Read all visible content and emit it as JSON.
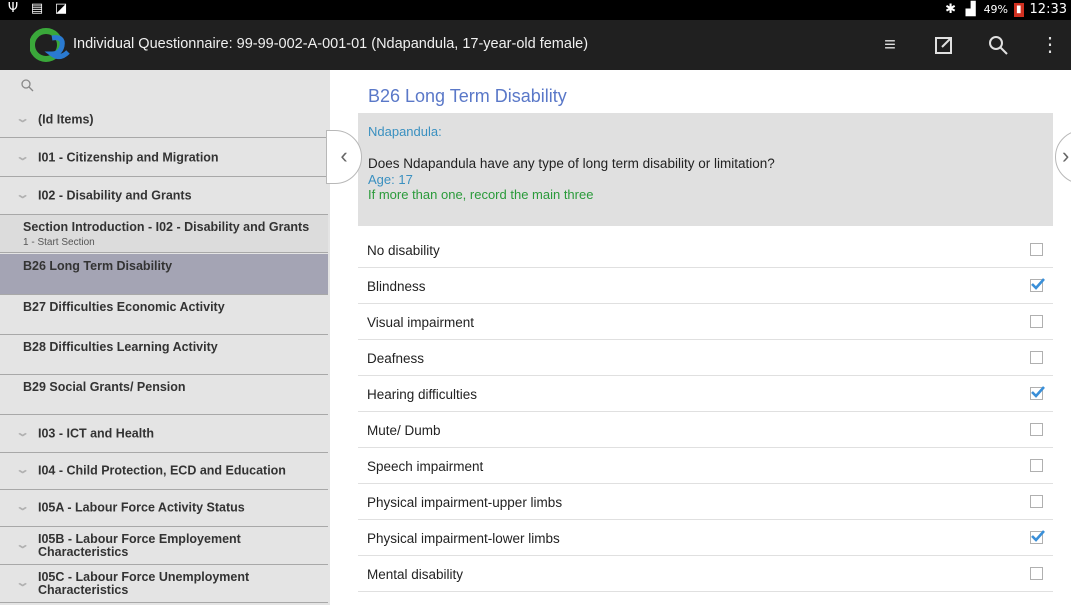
{
  "status_bar": {
    "battery": "49%",
    "time": "12:33"
  },
  "app": {
    "title": "Individual Questionnaire: 99-99-002-A-001-01 (Ndapandula, 17-year-old female)"
  },
  "sidebar": {
    "items": [
      {
        "label": "(Id Items)"
      },
      {
        "label": "I01 - Citizenship and Migration"
      },
      {
        "label": "I02 - Disability and Grants"
      },
      {
        "label": "Section Introduction - I02 - Disability and Grants",
        "sub": "1 - Start Section"
      },
      {
        "label": "B26 Long Term Disability"
      },
      {
        "label": "B27 Difficulties Economic Activity"
      },
      {
        "label": "B28 Difficulties Learning Activity"
      },
      {
        "label": "B29 Social Grants/ Pension"
      },
      {
        "label": "I03 - ICT and Health"
      },
      {
        "label": "I04 - Child Protection, ECD and Education"
      },
      {
        "label": "I05A - Labour Force Activity Status"
      },
      {
        "label": "I05B - Labour Force Employement Characteristics"
      },
      {
        "label": "I05C - Labour Force Unemployment Characteristics"
      }
    ]
  },
  "question": {
    "title": "B26 Long Term Disability",
    "respondent": "Ndapandula:",
    "text": "Does Ndapandula have any type of long term disability or limitation?",
    "age": "Age: 17",
    "note": "If more than one, record the main three"
  },
  "options": [
    {
      "label": "No disability",
      "checked": false
    },
    {
      "label": "Blindness",
      "checked": true
    },
    {
      "label": "Visual impairment",
      "checked": false
    },
    {
      "label": "Deafness",
      "checked": false
    },
    {
      "label": "Hearing difficulties",
      "checked": true
    },
    {
      "label": "Mute/ Dumb",
      "checked": false
    },
    {
      "label": "Speech impairment",
      "checked": false
    },
    {
      "label": "Physical impairment-upper limbs",
      "checked": false
    },
    {
      "label": "Physical impairment-lower limbs",
      "checked": true
    },
    {
      "label": "Mental disability",
      "checked": false
    }
  ],
  "colors": {
    "accent": "#5a78c8",
    "checkmark": "#3a8fd8",
    "note": "#2a9a3a",
    "active_nav": "#a4a4b4"
  }
}
